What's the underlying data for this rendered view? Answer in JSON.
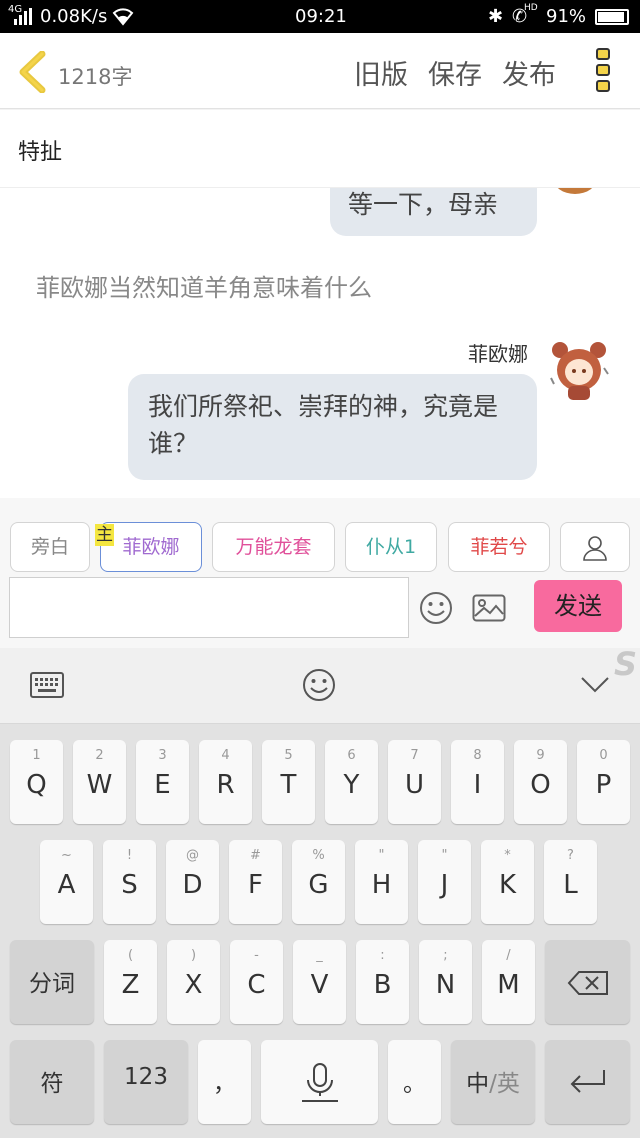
{
  "status": {
    "net_tag": "4G",
    "speed": "0.08K/s",
    "time": "09:21",
    "hd": "HD",
    "battery": "91%"
  },
  "appbar": {
    "word_count": "1218字",
    "old_version": "旧版",
    "save": "保存",
    "publish": "发布"
  },
  "subtitle": "特扯",
  "chat": {
    "partial_bubble": "等一下，母亲",
    "narration": "菲欧娜当然知道羊角意味着什么",
    "speaker": "菲欧娜",
    "message": "我们所祭祀、崇拜的神，究竟是谁？"
  },
  "roles": [
    {
      "label": "旁白",
      "color": "#888888"
    },
    {
      "label": "菲欧娜",
      "color": "#a06ad0",
      "badge": "主"
    },
    {
      "label": "万能龙套",
      "color": "#e0509a"
    },
    {
      "label": "仆从1",
      "color": "#3fa9a2"
    },
    {
      "label": "菲若兮",
      "color": "#e04848"
    }
  ],
  "composer": {
    "input_value": "",
    "send": "发送"
  },
  "keyboard": {
    "row1": [
      {
        "k": "Q",
        "h": "1"
      },
      {
        "k": "W",
        "h": "2"
      },
      {
        "k": "E",
        "h": "3"
      },
      {
        "k": "R",
        "h": "4"
      },
      {
        "k": "T",
        "h": "5"
      },
      {
        "k": "Y",
        "h": "6"
      },
      {
        "k": "U",
        "h": "7"
      },
      {
        "k": "I",
        "h": "8"
      },
      {
        "k": "O",
        "h": "9"
      },
      {
        "k": "P",
        "h": "0"
      }
    ],
    "row2": [
      {
        "k": "A",
        "h": "~"
      },
      {
        "k": "S",
        "h": "!"
      },
      {
        "k": "D",
        "h": "@"
      },
      {
        "k": "F",
        "h": "#"
      },
      {
        "k": "G",
        "h": "%"
      },
      {
        "k": "H",
        "h": "\""
      },
      {
        "k": "J",
        "h": "\""
      },
      {
        "k": "K",
        "h": "*"
      },
      {
        "k": "L",
        "h": "?"
      }
    ],
    "row3": [
      {
        "k": "Z",
        "h": "("
      },
      {
        "k": "X",
        "h": ")"
      },
      {
        "k": "C",
        "h": "-"
      },
      {
        "k": "V",
        "h": "_"
      },
      {
        "k": "B",
        "h": ":"
      },
      {
        "k": "N",
        "h": ";"
      },
      {
        "k": "M",
        "h": "/"
      }
    ],
    "fenci": "分词",
    "fu": "符",
    "num": "123",
    "comma": "，",
    "period": "。",
    "lang_zh": "中",
    "lang_sep": "/",
    "lang_en": "英",
    "brand": "S"
  }
}
